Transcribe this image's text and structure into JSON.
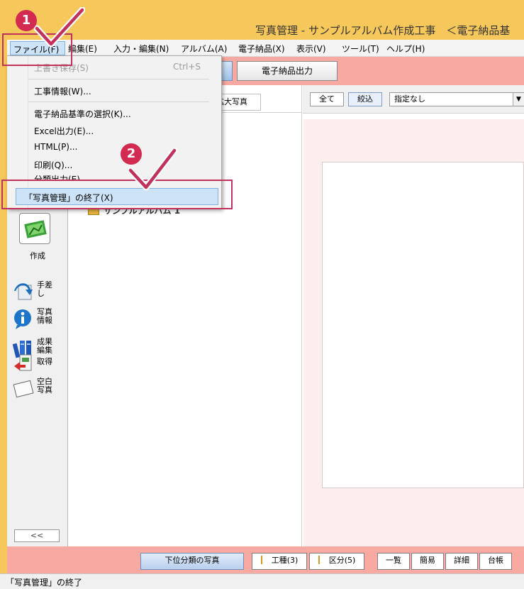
{
  "window": {
    "title": "写真管理 - サンプルアルバム作成工事　＜電子納品基"
  },
  "menubar": {
    "items": [
      {
        "label": "ファイル(F)"
      },
      {
        "label": "編集(E)"
      },
      {
        "label": "入力・編集(N)"
      },
      {
        "label": "アルバム(A)"
      },
      {
        "label": "電子納品(X)"
      },
      {
        "label": "表示(V)"
      },
      {
        "label": "ツール(T)"
      },
      {
        "label": "ヘルプ(H)"
      }
    ]
  },
  "toolbar": {
    "export_label": "電子納品出力"
  },
  "file_menu": {
    "items": [
      {
        "label": "上書き保存(S)",
        "shortcut": "Ctrl+S"
      },
      {
        "label": "工事情報(W)..."
      },
      {
        "label": "電子納品基準の選択(K)..."
      },
      {
        "label": "Excel出力(E)..."
      },
      {
        "label": "HTML(P)..."
      },
      {
        "label": "印刷(Q)..."
      },
      {
        "label": "分類出力(E)"
      },
      {
        "label": "「写真管理」の終了(X)"
      }
    ]
  },
  "tree": {
    "tab_label": "拡大写真",
    "album_label": "サンプルアルバム 1"
  },
  "tools": {
    "create_label": "作成",
    "items": [
      {
        "label": "手差し"
      },
      {
        "label": "写真情報"
      },
      {
        "label": "成果編集"
      },
      {
        "label": "取得"
      },
      {
        "label": "空白写真"
      }
    ],
    "collapse_label": "<<"
  },
  "filter": {
    "all_label": "全て",
    "narrow_label": "絞込",
    "select_value": "指定なし",
    "arrow": "▼"
  },
  "bottom": {
    "subphotos_label": "下位分類の写真",
    "koushu_label": "工種(3)",
    "kubun_label": "区分(5)",
    "list_label": "一覧",
    "simple_label": "簡易",
    "detail_label": "詳細",
    "ledger_label": "台帳"
  },
  "status": {
    "text": "「写真管理」の終了"
  },
  "annotations": {
    "badge_1": "1",
    "badge_2": "2"
  }
}
